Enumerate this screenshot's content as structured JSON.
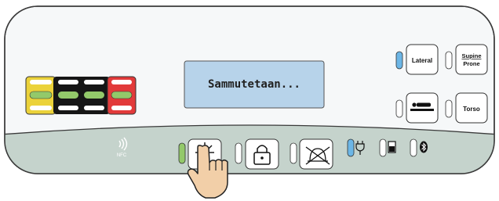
{
  "display": {
    "message": "Sammutetaan..."
  },
  "nfc": {
    "label": "NFC"
  },
  "side_buttons": {
    "lateral": {
      "label": "Lateral",
      "active": true
    },
    "supine_prone": {
      "label_line1": "Supine",
      "label_line2": "Prone",
      "active": false
    },
    "patient": {
      "icon": "patient-lying-icon",
      "active": false
    },
    "torso": {
      "label": "Torso",
      "active": false
    }
  },
  "bottom_buttons": {
    "power": {
      "icon": "power-sparkle-icon",
      "active": true
    },
    "lock": {
      "icon": "lock-icon",
      "active": false
    },
    "alarm": {
      "icon": "alarm-off-icon",
      "active": false
    }
  },
  "status_indicators": {
    "ac_power": {
      "icon": "plug-icon",
      "active": true
    },
    "battery": {
      "icon": "battery-icon",
      "active": false
    },
    "bluetooth": {
      "icon": "bluetooth-icon",
      "active": false
    }
  },
  "colors": {
    "indicator_blue": "#6cb6e6",
    "indicator_green": "#93c96a",
    "lcd_background": "#b7d3ea",
    "footer_band": "#c5d3cc",
    "bar_yellow": "#ebd23a",
    "bar_black": "#161616",
    "bar_red": "#e23a3a"
  }
}
